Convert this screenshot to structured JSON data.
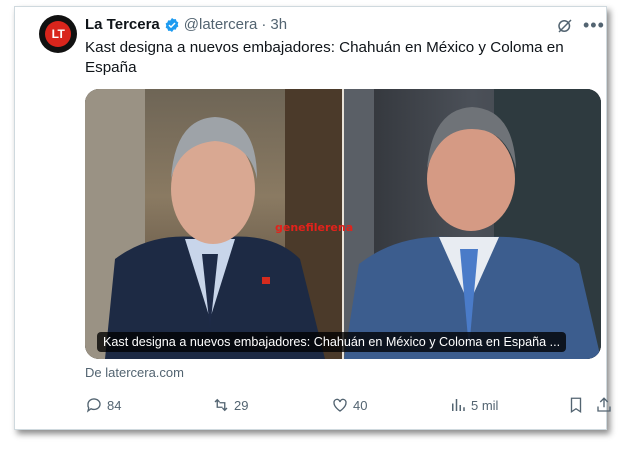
{
  "tweet": {
    "avatar_text": "LT",
    "display_name": "La Tercera",
    "handle": "@latercera",
    "separator": "·",
    "time": "3h",
    "text": "Kast designa a nuevos embajadores: Chahuán en México y Coloma en España"
  },
  "card": {
    "watermark": "genefilerena",
    "caption": "Kast designa a nuevos embajadores: Chahuán en México y Coloma en España ...",
    "source": "De latercera.com"
  },
  "actions": {
    "replies": "84",
    "retweets": "29",
    "likes": "40",
    "views": "5 mil"
  },
  "colors": {
    "verified": "#1d9bf0",
    "secondary_text": "#536471",
    "brand_red": "#d9251c"
  }
}
